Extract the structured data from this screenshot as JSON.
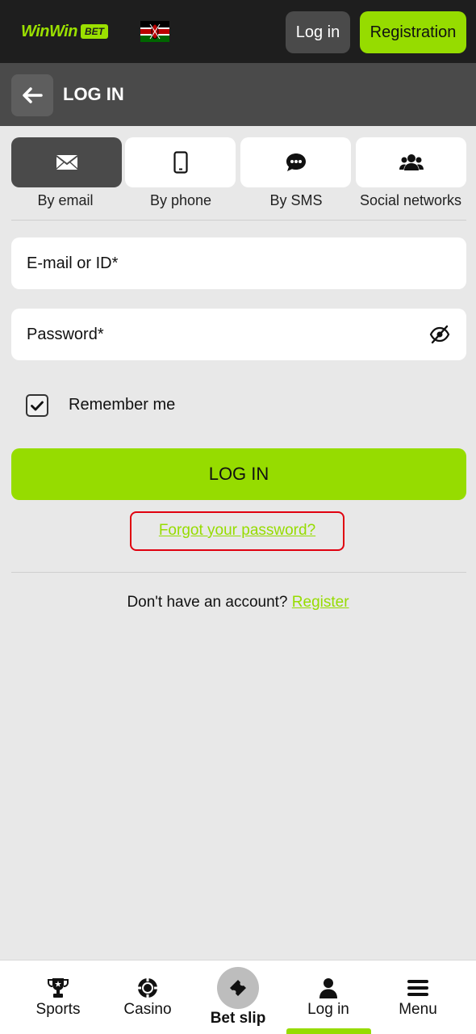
{
  "header": {
    "logo_text": "WinWin",
    "logo_badge": "BET",
    "flag": "kenya-flag",
    "login_label": "Log in",
    "register_label": "Registration"
  },
  "subheader": {
    "back_icon": "arrow-left-icon",
    "title": "LOG IN"
  },
  "login_methods": [
    {
      "label": "By email",
      "icon": "envelope-icon",
      "active": true
    },
    {
      "label": "By phone",
      "icon": "smartphone-icon",
      "active": false
    },
    {
      "label": "By SMS",
      "icon": "chat-bubble-icon",
      "active": false
    },
    {
      "label": "Social networks",
      "icon": "users-icon",
      "active": false
    }
  ],
  "form": {
    "email_placeholder": "E-mail or ID*",
    "password_placeholder": "Password*",
    "password_toggle_icon": "eye-slash-icon",
    "remember_label": "Remember me",
    "remember_checked": true,
    "submit_label": "LOG IN",
    "forgot_label": "Forgot your password?",
    "no_account_text": "Don't have an account?",
    "register_link": "Register"
  },
  "bottom_nav": [
    {
      "label": "Sports",
      "icon": "trophy-icon"
    },
    {
      "label": "Casino",
      "icon": "casino-chip-icon"
    },
    {
      "label": "Bet slip",
      "icon": "ticket-icon"
    },
    {
      "label": "Log in",
      "icon": "user-icon",
      "active": true
    },
    {
      "label": "Menu",
      "icon": "hamburger-icon"
    }
  ],
  "colors": {
    "accent": "#96dc00",
    "header_bg": "#1e1e1e",
    "subheader_bg": "#4a4a4a",
    "page_bg": "#e8e8e8",
    "highlight_border": "#e0000f"
  }
}
